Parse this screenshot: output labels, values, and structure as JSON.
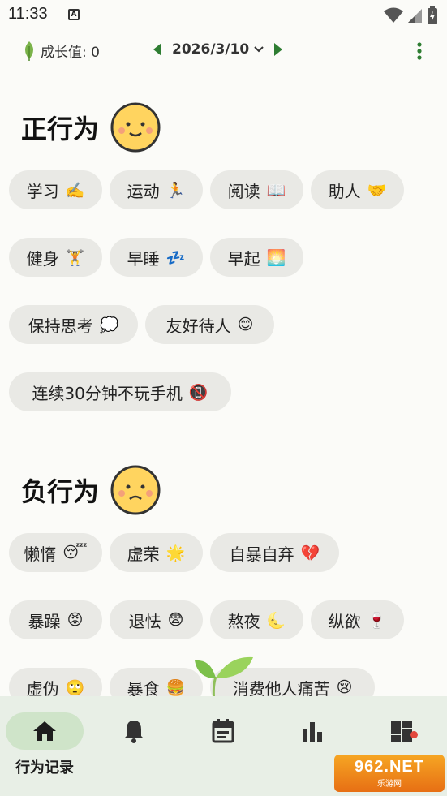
{
  "status_bar": {
    "time": "11:33",
    "a_icon": "A"
  },
  "topbar": {
    "growth_label": "成长值: 0",
    "date": "2026/3/10",
    "icons": [
      "leaf-icon",
      "chevron-left-icon",
      "chevron-down-icon",
      "chevron-right-icon",
      "more-vert-icon"
    ]
  },
  "positive": {
    "title": "正行为",
    "face": "smile-face-icon",
    "chips": [
      {
        "label": "学习",
        "emoji": "✍️"
      },
      {
        "label": "运动",
        "emoji": "🏃"
      },
      {
        "label": "阅读",
        "emoji": "📖"
      },
      {
        "label": "助人",
        "emoji": "🤝"
      },
      {
        "label": "健身",
        "emoji": "🏋️"
      },
      {
        "label": "早睡",
        "emoji": "💤"
      },
      {
        "label": "早起",
        "emoji": "🌅"
      },
      {
        "label": "保持思考",
        "emoji": "💭"
      },
      {
        "label": "友好待人",
        "emoji": "😊"
      },
      {
        "label": "连续30分钟不玩手机",
        "emoji": "📵"
      }
    ]
  },
  "negative": {
    "title": "负行为",
    "face": "frown-face-icon",
    "chips": [
      {
        "label": "懒惰",
        "emoji": "😴"
      },
      {
        "label": "虚荣",
        "emoji": "🌟"
      },
      {
        "label": "自暴自弃",
        "emoji": "💔"
      },
      {
        "label": "暴躁",
        "emoji": "😡"
      },
      {
        "label": "退怯",
        "emoji": "😨"
      },
      {
        "label": "熬夜",
        "emoji": "🌜"
      },
      {
        "label": "纵欲",
        "emoji": "🍷"
      },
      {
        "label": "虚伪",
        "emoji": "🙄"
      },
      {
        "label": "暴食",
        "emoji": "🍔"
      },
      {
        "label": "消费他人痛苦",
        "emoji": "😢"
      }
    ]
  },
  "bottom_nav": {
    "items": [
      {
        "icon": "home-icon",
        "label": "行为记录",
        "active": true
      },
      {
        "icon": "bell-icon",
        "label": ""
      },
      {
        "icon": "calendar-icon",
        "label": ""
      },
      {
        "icon": "bar-chart-icon",
        "label": ""
      },
      {
        "icon": "dashboard-icon",
        "label": ""
      }
    ]
  },
  "watermark": {
    "top": "962.NET",
    "bottom": "乐游网"
  },
  "colors": {
    "chip_bg": "#e9e9e5",
    "nav_bg": "#e8efe6",
    "nav_active": "#cfe4c9",
    "accent_green": "#2e7d32"
  }
}
